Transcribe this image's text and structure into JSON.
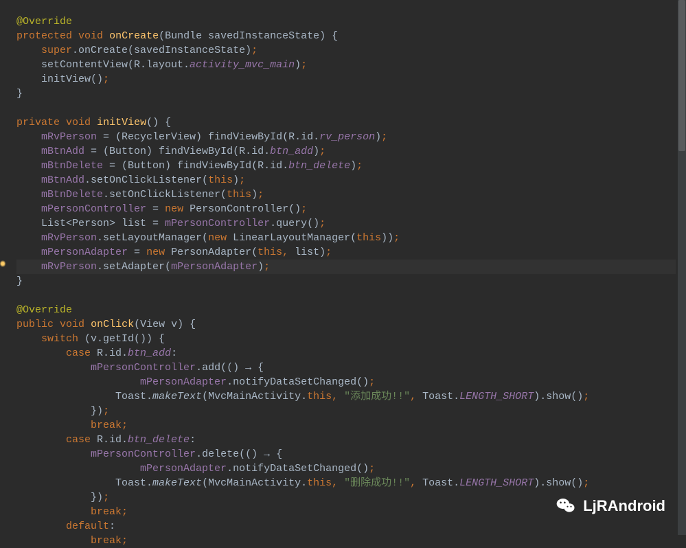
{
  "watermark": {
    "label": "LjRAndroid"
  },
  "code": {
    "l1": "@Override",
    "l2a": "protected",
    "l2b": "void",
    "l2c": "onCreate",
    "l2d": "(Bundle savedInstanceState) {",
    "l3a": "super",
    "l3b": ".onCreate(savedInstanceState)",
    "l4a": "    setContentView(R.layout.",
    "l4b": "activity_mvc_main",
    "l4c": ")",
    "l5a": "    initView()",
    "l6": "}",
    "l8a": "private",
    "l8b": "void",
    "l8c": "initView",
    "l8d": "() {",
    "l9a": "mRvPerson",
    "l9b": " = (RecyclerView) findViewById(R.id.",
    "l9c": "rv_person",
    "l9d": ")",
    "l10a": "mBtnAdd",
    "l10b": " = (Button) findViewById(R.id.",
    "l10c": "btn_add",
    "l10d": ")",
    "l11a": "mBtnDelete",
    "l11b": " = (Button) findViewById(R.id.",
    "l11c": "btn_delete",
    "l11d": ")",
    "l12a": "mBtnAdd",
    "l12b": ".setOnClickListener(",
    "l12c": "this",
    "l12d": ")",
    "l13a": "mBtnDelete",
    "l13b": ".setOnClickListener(",
    "l13c": "this",
    "l13d": ")",
    "l14a": "mPersonController",
    "l14b": " = ",
    "l14c": "new",
    "l14d": " PersonController()",
    "l15a": "    List<Person> list = ",
    "l15b": "mPersonController",
    "l15c": ".query()",
    "l16a": "mRvPerson",
    "l16b": ".setLayoutManager(",
    "l16c": "new",
    "l16d": " LinearLayoutManager(",
    "l16e": "this",
    "l16f": "))",
    "l17a": "mPersonAdapter",
    "l17b": " = ",
    "l17c": "new",
    "l17d": " PersonAdapter(",
    "l17e": "this",
    "l17f": ", ",
    "l17g": "list)",
    "l18a": "mRvPerson",
    "l18b": ".setAdapter(",
    "l18c": "mPersonAdapter",
    "l18d": ")",
    "l19": "}",
    "l21": "@Override",
    "l22a": "public",
    "l22b": "void",
    "l22c": "onClick",
    "l22d": "(View v) {",
    "l23a": "switch",
    "l23b": " (v.getId()) {",
    "l24a": "case",
    "l24b": " R.id.",
    "l24c": "btn_add",
    "l24d": ":",
    "l25a": "mPersonController",
    "l25b": ".add(",
    "l25c": "() ",
    "l25d": "→",
    "l25e": " {",
    "l26a": "mPersonAdapter",
    "l26b": ".notifyDataSetChanged()",
    "l27a": "                Toast.",
    "l27b": "makeText",
    "l27c": "(MvcMainActivity.",
    "l27d": "this",
    "l27e": ", ",
    "l27f": "\"添加成功!!\"",
    "l27g": ", ",
    "l27h": "Toast.",
    "l27i": "LENGTH_SHORT",
    "l27j": ").show()",
    "l28a": "}",
    "l28b": ")",
    "l29a": "break",
    "l30a": "case",
    "l30b": " R.id.",
    "l30c": "btn_delete",
    "l30d": ":",
    "l31a": "mPersonController",
    "l31b": ".delete(",
    "l31c": "() ",
    "l31d": "→",
    "l31e": " {",
    "l32a": "mPersonAdapter",
    "l32b": ".notifyDataSetChanged()",
    "l33a": "                Toast.",
    "l33b": "makeText",
    "l33c": "(MvcMainActivity.",
    "l33d": "this",
    "l33e": ", ",
    "l33f": "\"删除成功!!\"",
    "l33g": ", ",
    "l33h": "Toast.",
    "l33i": "LENGTH_SHORT",
    "l33j": ").show()",
    "l34a": "}",
    "l34b": ")",
    "l35a": "break",
    "l36a": "default",
    "l36b": ":",
    "l37a": "break"
  }
}
